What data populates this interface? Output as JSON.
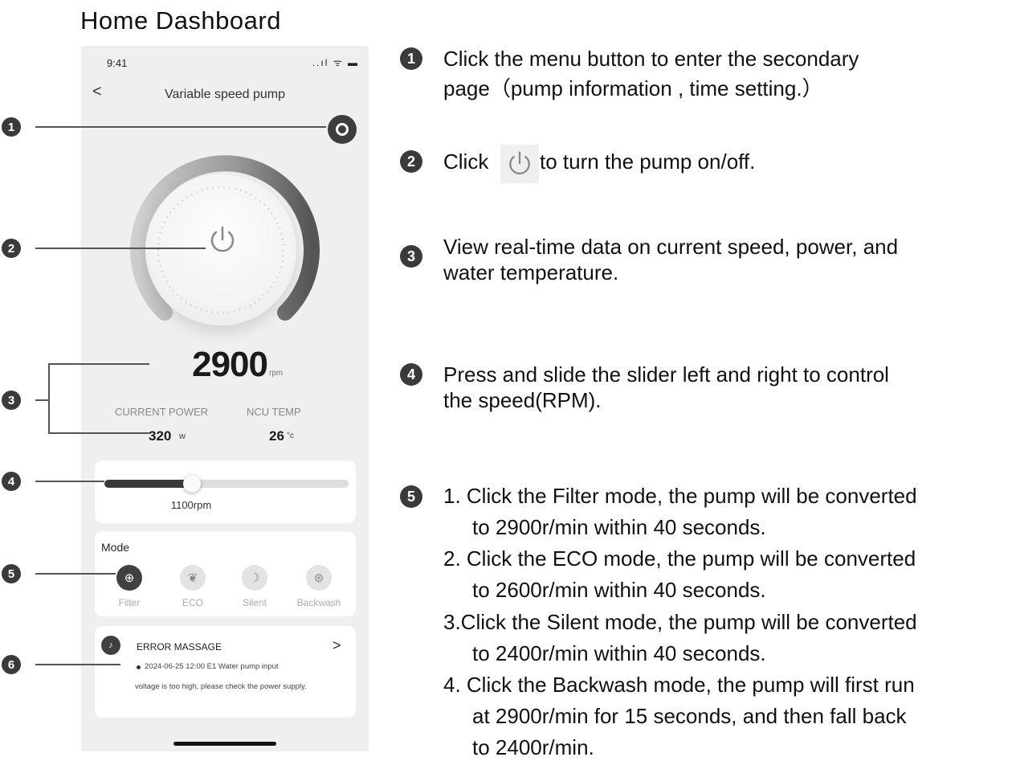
{
  "page_title": "Home Dashboard",
  "phone": {
    "status_time": "9:41",
    "status_icons": "..ıl ᯤ ▬",
    "back_symbol": "<",
    "title": "Variable speed pump",
    "rpm_value": "2900",
    "rpm_unit": "rpm",
    "current_power_label": "CURRENT POWER",
    "ncu_temp_label": "NCU TEMP",
    "power_value": "320",
    "power_unit": "w",
    "temp_value": "26",
    "temp_unit": "°c",
    "slider": {
      "label": "1100rpm",
      "level": 0.36
    },
    "mode": {
      "title": "Mode",
      "items": [
        {
          "label": "Filter",
          "icon": "filter-icon",
          "glyph": "⊕",
          "active": true
        },
        {
          "label": "ECO",
          "icon": "leaf-icon",
          "glyph": "❦",
          "active": false
        },
        {
          "label": "Silent",
          "icon": "moon-icon",
          "glyph": "☽",
          "active": false
        },
        {
          "label": "Backwash",
          "icon": "backwash-icon",
          "glyph": "⊛",
          "active": false
        }
      ]
    },
    "error": {
      "title": "ERROR MASSAGE",
      "chevron": ">",
      "line1": "2024-06-25 12:00 E1 Water pump input",
      "line2": "voltage is too high, please check the power supply."
    }
  },
  "callout_numbers": [
    "1",
    "2",
    "3",
    "4",
    "5",
    "6"
  ],
  "instructions": {
    "n1": "1",
    "t1a": "Click the menu button to enter the secondary",
    "t1b": "page（pump information , time setting.）",
    "n2": "2",
    "t2a": "Click",
    "t2b": "to turn the pump on/off.",
    "n3": "3",
    "t3a": "View real-time data on current speed, power, and",
    "t3b": "water temperature.",
    "n4": "4",
    "t4a": "Press and slide the slider left and right to control",
    "t4b": "the speed(RPM).",
    "n5": "5",
    "t5_1a": "1. Click the Filter mode, the pump will be converted",
    "t5_1b": "to 2900r/min within 40 seconds.",
    "t5_2a": "2. Click the ECO mode, the pump will be converted",
    "t5_2b": "to 2600r/min within 40 seconds.",
    "t5_3a": "3.Click the Silent mode, the pump will be converted",
    "t5_3b": "to 2400r/min within 40 seconds.",
    "t5_4a": "4. Click the Backwash mode, the pump will first run",
    "t5_4b": "at 2900r/min for 15 seconds, and then fall back",
    "t5_4c": "to 2400r/min."
  },
  "colors": {
    "accent_dark": "#3a3a3a",
    "phone_bg": "#efefef"
  }
}
